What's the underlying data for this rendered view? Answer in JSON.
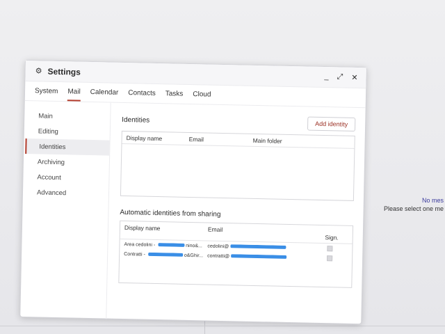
{
  "background": {
    "empty_title": "No mes",
    "empty_hint": "Please select one me"
  },
  "dialog": {
    "title": "Settings",
    "window_buttons": {
      "minimize": "_",
      "maximize": "⤢",
      "close": "✕"
    },
    "tabs": [
      {
        "label": "System"
      },
      {
        "label": "Mail"
      },
      {
        "label": "Calendar"
      },
      {
        "label": "Contacts"
      },
      {
        "label": "Tasks"
      },
      {
        "label": "Cloud"
      }
    ],
    "active_tab": "Mail",
    "sidebar": [
      {
        "label": "Main"
      },
      {
        "label": "Editing"
      },
      {
        "label": "Identities"
      },
      {
        "label": "Archiving"
      },
      {
        "label": "Account"
      },
      {
        "label": "Advanced"
      }
    ],
    "active_sidebar": "Identities",
    "identities": {
      "title": "Identities",
      "add_button": "Add identity",
      "columns": [
        "Display name",
        "Email",
        "Main folder"
      ]
    },
    "auto_identities": {
      "title": "Automatic identities from sharing",
      "columns": [
        "Display name",
        "Email",
        "Sign."
      ],
      "rows": [
        {
          "name_prefix": "Area cedolini - ",
          "name_suffix": "nino&...",
          "email_prefix": "cedolini@"
        },
        {
          "name_prefix": "Contratti - ",
          "name_suffix": "o&Ghir...",
          "email_prefix": "contratti@"
        }
      ]
    }
  },
  "colors": {
    "accent": "#b33b2b",
    "mask": "#3a8ee6"
  }
}
